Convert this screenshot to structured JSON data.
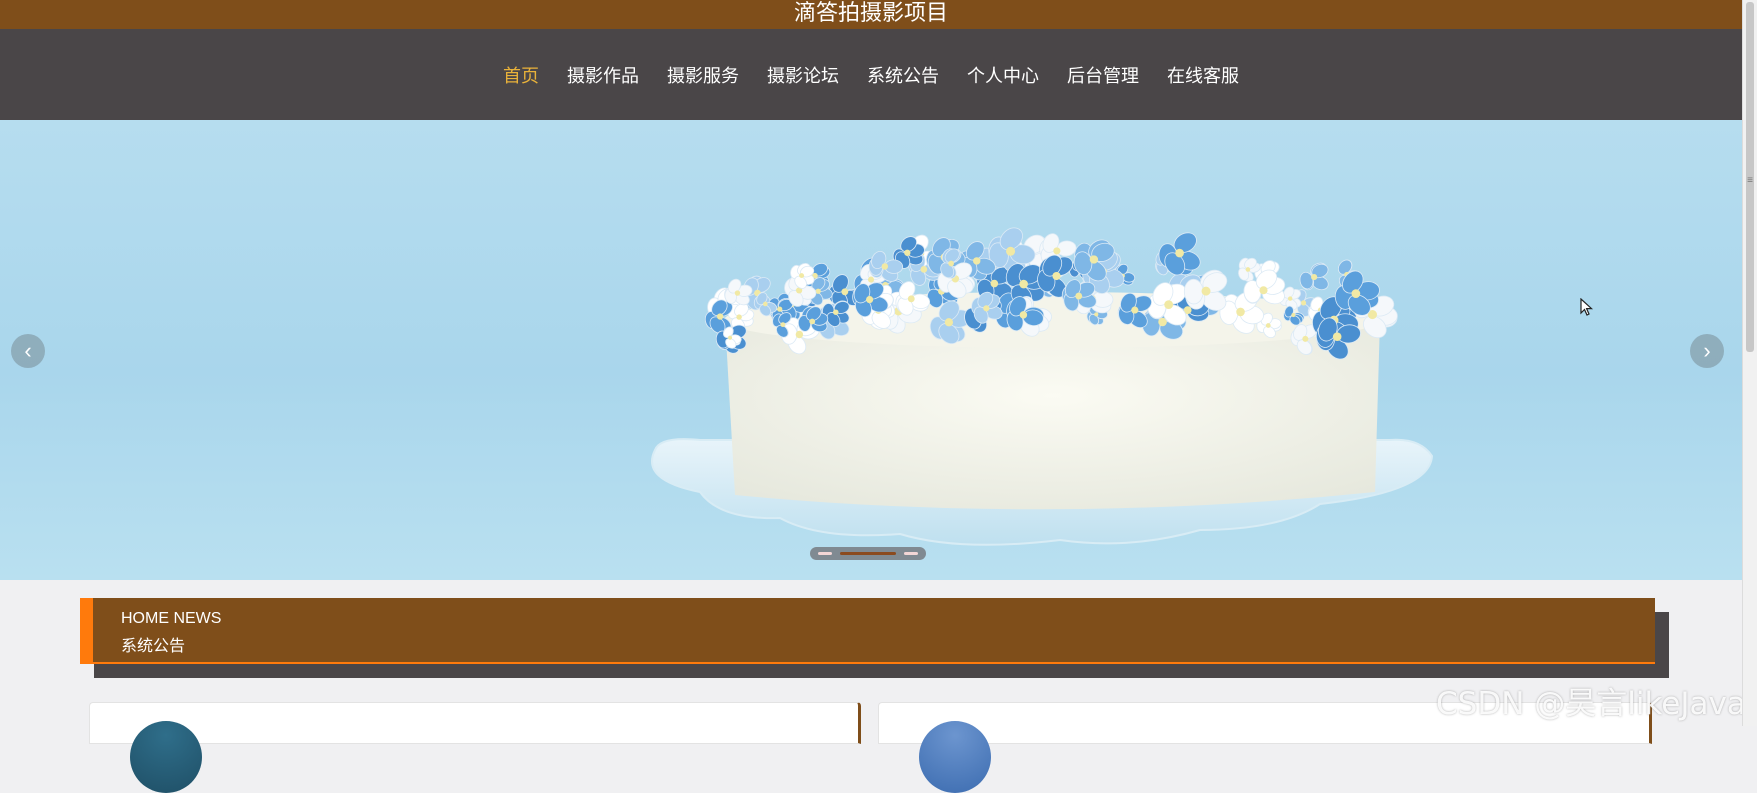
{
  "site": {
    "title": "滴答拍摄影项目"
  },
  "nav": {
    "items": [
      {
        "label": "首页",
        "active": true
      },
      {
        "label": "摄影作品"
      },
      {
        "label": "摄影服务"
      },
      {
        "label": "摄影论坛"
      },
      {
        "label": "系统公告"
      },
      {
        "label": "个人中心"
      },
      {
        "label": "后台管理"
      },
      {
        "label": "在线客服"
      }
    ]
  },
  "carousel": {
    "prev_icon": "chevron-left-icon",
    "next_icon": "chevron-right-icon",
    "slides": 3,
    "active_slide": 2
  },
  "news": {
    "title_en": "HOME NEWS",
    "title_cn": "系统公告"
  },
  "watermark": "CSDN @昊言likeJava",
  "colors": {
    "brand": "#7f4e1a",
    "accent": "#ff7a0c",
    "nav_bg": "#4a4648",
    "nav_active": "#e9b23a"
  }
}
